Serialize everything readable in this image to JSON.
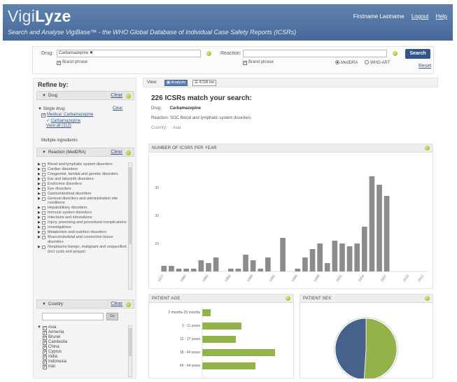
{
  "header": {
    "logo_light": "Vigi",
    "logo_bold": "Lyze",
    "tagline": "Search and Analyse VigiBase™ - the WHO Global Database of Individual Case Safety Reports (ICSRs)",
    "user_name": "Firstname Lastname",
    "logout": "Logout",
    "help": "Help"
  },
  "search": {
    "drug_label": "Drug:",
    "drug_value": "Carbamazepine ✖",
    "drug_check": "Brand phrase",
    "reaction_label": "Reaction:",
    "reaction_value": "",
    "reaction_check": "Brand phrase",
    "radio_meddra": "MedDRA",
    "radio_whoart": "WHO-ART",
    "search_button": "Search",
    "reset_link": "Reset"
  },
  "refine": {
    "title": "Refine by:",
    "drug_section": "Drug",
    "clear": "Clear",
    "single_drug_label": "Single drug:",
    "single_drug_clear": "Clear",
    "single_drug_item": "Medical: Carbamazepine",
    "single_drug_sub": "Carbamazepine",
    "view_all": "View all (112)",
    "multiple_ingredients": "Multiple ingredients",
    "reaction_section": "Reaction (MedDRA)",
    "reaction_tree": [
      "Blood and lymphatic system disorders",
      "Cardiac disorders",
      "Congenital, familial and genetic disorders",
      "Ear and labyrinth disorders",
      "Endocrine disorders",
      "Eye disorders",
      "Gastrointestinal disorders",
      "General disorders and administration site conditions",
      "Hepatobiliary disorders",
      "Immune system disorders",
      "Infections and infestations",
      "Injury, poisoning and procedural complications",
      "Investigations",
      "Metabolism and nutrition disorders",
      "Musculoskeletal and connective tissue disorders",
      "Neoplasms benign, malignant and unspecified (incl cysts and polyps)"
    ],
    "country_section": "Country",
    "country_button": "Go",
    "countries": [
      "Asia",
      "Armenia",
      "Brunei",
      "Cambodia",
      "China",
      "Cyprus",
      "India",
      "Indonesia",
      "Iran"
    ]
  },
  "main": {
    "view_label": "View:",
    "view_analysis": "Analysis",
    "view_icsr_list": "ICSR list",
    "match_title": "226 ICSRs match your search:",
    "drug_line_label": "Drug:",
    "drug_line_value": "Carbamazepine",
    "reaction_line": "Reaction: SOC Blood and lymphatic system disorders",
    "country_line_label": "Country:",
    "country_line_value": "Asia"
  },
  "colors": {
    "header": "#4f73a3",
    "bar": "#8c8c8c",
    "age_bar": "#94b24a",
    "sex_female": "#94b24a",
    "sex_male": "#46628a"
  },
  "chart_data": [
    {
      "type": "bar",
      "title": "NUMBER OF ICSRS PER YEAR",
      "categories": [
        "1977",
        "1978",
        "1979",
        "1980",
        "1981",
        "1982",
        "1983",
        "1984",
        "1985",
        "1986",
        "1987",
        "1988",
        "1989",
        "1990",
        "1991",
        "1992",
        "1993",
        "1994",
        "1995",
        "1996",
        "1997",
        "1998",
        "1999",
        "2000",
        "2001",
        "2002",
        "2003",
        "2004",
        "2005",
        "2006",
        "2007",
        "2008",
        "2009",
        "2010",
        "2011",
        "2012"
      ],
      "values": [
        2,
        2,
        1,
        1,
        1,
        4,
        3,
        5,
        0,
        1,
        1,
        6,
        4,
        1,
        5,
        0,
        12,
        0,
        1,
        5,
        8,
        10,
        3,
        11,
        10,
        9,
        10,
        16,
        34,
        31,
        27,
        0,
        0,
        0,
        0,
        0
      ],
      "ytick_labels": [
        "10",
        "20",
        "30"
      ],
      "xtick_labels": [
        "1977",
        "1980",
        "1983",
        "1986",
        "1989",
        "1992",
        "1995",
        "1998",
        "2001",
        "2004",
        "2007",
        "2010",
        "2012"
      ],
      "ylim": [
        0,
        40
      ]
    },
    {
      "type": "bar",
      "title": "PATIENT AGE",
      "categories": [
        "2 months-23 months",
        "2 - 11 years",
        "12 - 17 years",
        "18 - 44 years",
        "45 - 64 years"
      ],
      "values": [
        3,
        14,
        12,
        26,
        19
      ]
    },
    {
      "type": "pie",
      "title": "PATIENT SEX",
      "categories": [
        "Female",
        "Male"
      ],
      "values": [
        51,
        49
      ]
    }
  ]
}
